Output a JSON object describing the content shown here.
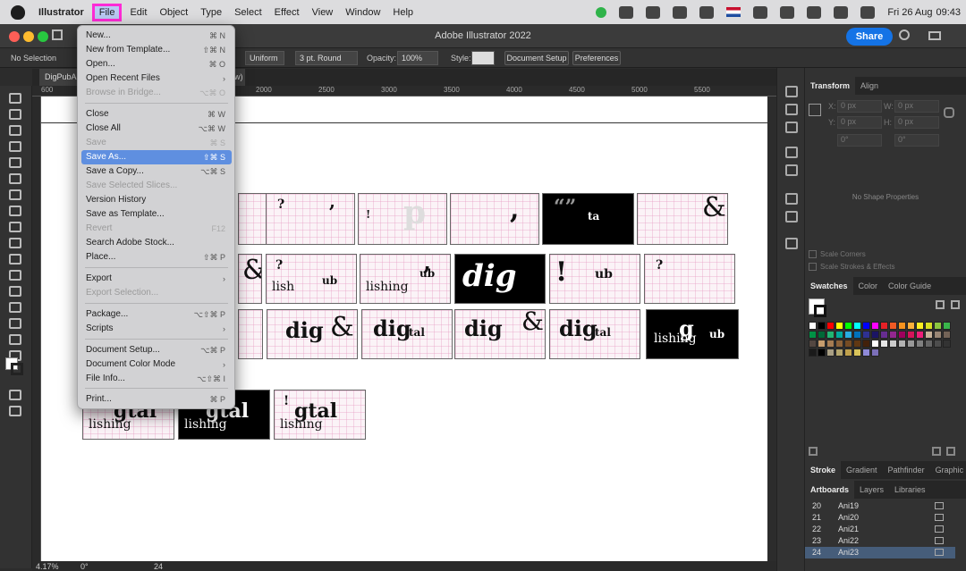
{
  "menubar": {
    "app": "Illustrator",
    "items": [
      "File",
      "Edit",
      "Object",
      "Type",
      "Select",
      "Effect",
      "View",
      "Window",
      "Help"
    ],
    "date": "Fri 26 Aug",
    "time": "09:43"
  },
  "titlebar": {
    "title": "Adobe Illustrator 2022",
    "share": "Share"
  },
  "control": {
    "selection": "No Selection",
    "uniform": "Uniform",
    "stroke_style": "3 pt. Round",
    "opacity_label": "Opacity:",
    "opacity": "100%",
    "style_label": "Style:",
    "doc_setup": "Document Setup",
    "preferences": "Preferences"
  },
  "tab": {
    "name": "DigPubAr",
    "suffix": "w)"
  },
  "ruler": [
    "600",
    "2000",
    "2500",
    "3000",
    "3500",
    "4000",
    "4500",
    "5000",
    "5500"
  ],
  "status": {
    "zoom": "4.17%",
    "rotation": "0°",
    "artboard": "24"
  },
  "file_menu": [
    {
      "label": "New...",
      "shortcut": "⌘ N",
      "disabled": false
    },
    {
      "label": "New from Template...",
      "shortcut": "⇧⌘ N",
      "disabled": false
    },
    {
      "label": "Open...",
      "shortcut": "⌘ O",
      "disabled": false
    },
    {
      "label": "Open Recent Files",
      "shortcut": "›",
      "disabled": false
    },
    {
      "label": "Browse in Bridge...",
      "shortcut": "⌥⌘ O",
      "disabled": true
    },
    {
      "label": "Close",
      "shortcut": "⌘ W",
      "disabled": false
    },
    {
      "label": "Close All",
      "shortcut": "⌥⌘ W",
      "disabled": false
    },
    {
      "label": "Save",
      "shortcut": "⌘ S",
      "disabled": true
    },
    {
      "label": "Save As...",
      "shortcut": "⇧⌘ S",
      "disabled": false,
      "highlighted": true
    },
    {
      "label": "Save a Copy...",
      "shortcut": "⌥⌘ S",
      "disabled": false
    },
    {
      "label": "Save Selected Slices...",
      "shortcut": "",
      "disabled": true
    },
    {
      "label": "Version History",
      "shortcut": "",
      "disabled": false
    },
    {
      "label": "Save as Template...",
      "shortcut": "",
      "disabled": false
    },
    {
      "label": "Revert",
      "shortcut": "F12",
      "disabled": true
    },
    {
      "label": "Search Adobe Stock...",
      "shortcut": "",
      "disabled": false
    },
    {
      "label": "Place...",
      "shortcut": "⇧⌘ P",
      "disabled": false
    },
    {
      "label": "Export",
      "shortcut": "›",
      "disabled": false
    },
    {
      "label": "Export Selection...",
      "shortcut": "",
      "disabled": true
    },
    {
      "label": "Package...",
      "shortcut": "⌥⇧⌘ P",
      "disabled": false
    },
    {
      "label": "Scripts",
      "shortcut": "›",
      "disabled": false
    },
    {
      "label": "Document Setup...",
      "shortcut": "⌥⌘ P",
      "disabled": false
    },
    {
      "label": "Document Color Mode",
      "shortcut": "›",
      "disabled": false
    },
    {
      "label": "File Info...",
      "shortcut": "⌥⇧⌘ I",
      "disabled": false
    },
    {
      "label": "Print...",
      "shortcut": "⌘ P",
      "disabled": false
    }
  ],
  "transform_panel": {
    "tabs": [
      "Transform",
      "Align"
    ],
    "x_label": "X:",
    "y_label": "Y:",
    "w_label": "W:",
    "h_label": "H:",
    "x": "0 px",
    "y": "0 px",
    "w": "0 px",
    "h": "0 px",
    "angle": "0°",
    "shear": "0°",
    "empty": "No Shape Properties",
    "scale_corners": "Scale Corners",
    "scale_strokes": "Scale Strokes & Effects"
  },
  "swatches_panel": {
    "tabs": [
      "Swatches",
      "Color",
      "Color Guide"
    ]
  },
  "stroke_tabs": [
    "Stroke",
    "Gradient",
    "Pathfinder",
    "Graphic"
  ],
  "artboards_panel": {
    "tabs": [
      "Artboards",
      "Layers",
      "Libraries"
    ],
    "rows": [
      {
        "num": "20",
        "name": "Ani19"
      },
      {
        "num": "21",
        "name": "Ani20"
      },
      {
        "num": "22",
        "name": "Ani21"
      },
      {
        "num": "23",
        "name": "Ani22"
      },
      {
        "num": "24",
        "name": "Ani23"
      }
    ]
  }
}
